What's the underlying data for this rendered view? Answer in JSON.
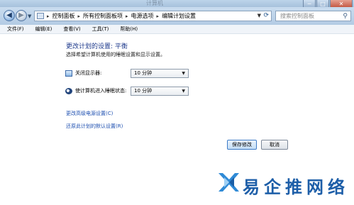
{
  "window": {
    "title": "计算机",
    "min": "─",
    "max": "□",
    "close": "✕"
  },
  "nav": {
    "breadcrumbs": [
      "控制面板",
      "所有控制面板项",
      "电源选项",
      "编辑计划设置"
    ],
    "search_placeholder": "搜索控制面板"
  },
  "menu": [
    "文件(F)",
    "编辑(E)",
    "查看(V)",
    "工具(T)",
    "帮助(H)"
  ],
  "main": {
    "heading": "更改计划的设置: 平衡",
    "subtitle": "选择希望计算机使用的睡眠设置和显示设置。",
    "settings": [
      {
        "label": "关闭显示器:",
        "value": "10 分钟",
        "icon": "monitor-icon"
      },
      {
        "label": "使计算机进入睡眠状态:",
        "value": "10 分钟",
        "icon": "sleep-moon-icon"
      }
    ],
    "links": [
      "更改高级电源设置(C)",
      "还原此计划的默认设置(R)"
    ],
    "buttons": {
      "save": "保存修改",
      "cancel": "取消"
    }
  },
  "watermark": {
    "text": "易企推网络"
  },
  "colors": {
    "heading": "#1e3a8c",
    "link": "#1d4fb0",
    "watermark": "#1d5ea8"
  }
}
